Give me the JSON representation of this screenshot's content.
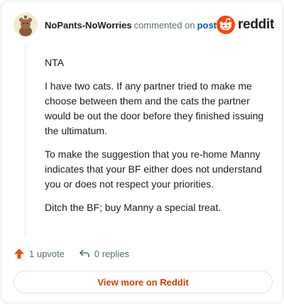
{
  "comment": {
    "username": "NoPants-NoWorries",
    "action_text": "commented on",
    "post_link": "post",
    "paragraphs": [
      "NTA",
      "I have two cats. If any partner tried to make me choose between them and the cats the partner would be out the door before they finished issuing the ultimatum.",
      "To make the suggestion that you re-home Manny indicates that your BF either does not understand you or does not respect your priorities.",
      "Ditch the BF; buy Manny a special treat."
    ]
  },
  "brand": {
    "logo_text": "reddit",
    "color": "#ff4500"
  },
  "footer": {
    "upvote_label": "1 upvote",
    "replies_label": "0 replies",
    "view_more_label": "View more on Reddit"
  },
  "icons": [
    "avatar",
    "reddit-logo-icon",
    "upvote-arrow-icon",
    "reply-icon"
  ]
}
